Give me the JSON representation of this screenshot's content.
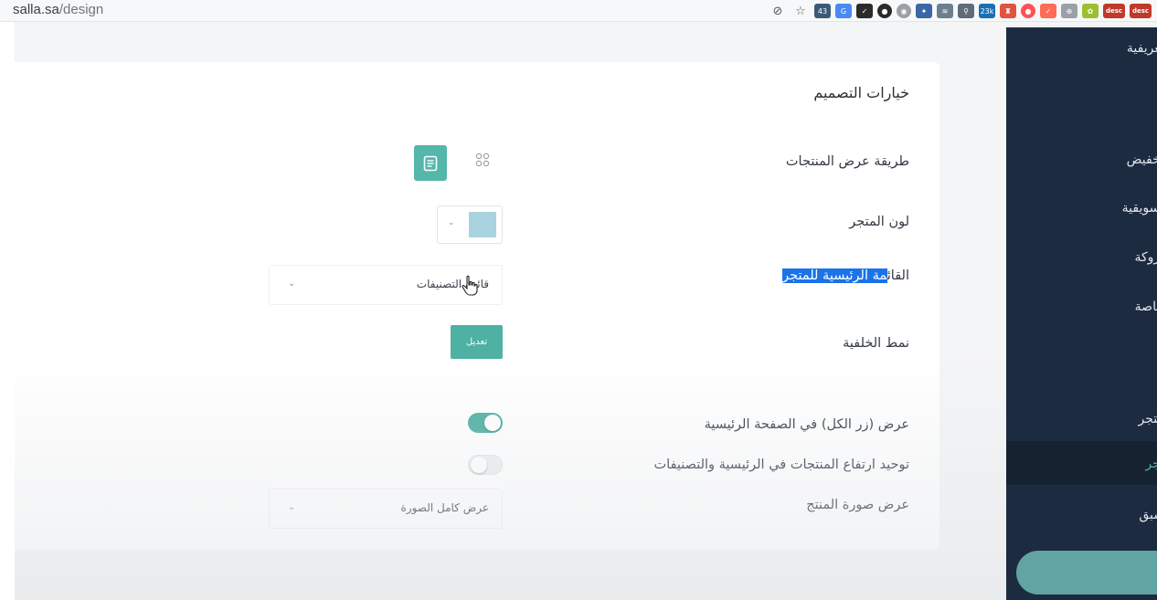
{
  "browser": {
    "url_domain": "salla.sa",
    "url_path": "/design",
    "extensions": [
      {
        "name": "eye-off-icon",
        "glyph": "⊘"
      },
      {
        "name": "star-icon",
        "glyph": "☆"
      },
      {
        "name": "extension-badge-43",
        "text": "43",
        "color": "#3b5a78"
      },
      {
        "name": "translate-extension-icon",
        "text": "G",
        "color": "#4a8af4"
      },
      {
        "name": "pocket-extension-icon",
        "text": "✓",
        "color": "#2b2b2b"
      },
      {
        "name": "extension-dark-circle-icon",
        "text": "●",
        "color": "#2a2a2a"
      },
      {
        "name": "extension-grey-circle-icon",
        "text": "◉",
        "color": "#9aa0a6"
      },
      {
        "name": "extension-spark-icon",
        "text": "✦",
        "color": "#3b67a8"
      },
      {
        "name": "rss-extension-icon",
        "text": "≋",
        "color": "#6c7f8f"
      },
      {
        "name": "link-extension-icon",
        "text": "⚲",
        "color": "#5f6b78"
      },
      {
        "name": "extension-badge-23k",
        "text": "23k",
        "color": "#1a6fb5"
      },
      {
        "name": "extension-lighthouse-icon",
        "text": "♜",
        "color": "#e0533f"
      },
      {
        "name": "extension-red-circle-icon",
        "text": "●",
        "color": "#ff5252"
      },
      {
        "name": "extension-red-check-icon",
        "text": "✓",
        "color": "#ff6b57"
      },
      {
        "name": "globe-extension-icon",
        "text": "⊕",
        "color": "#9aa0a6"
      },
      {
        "name": "extension-flower-icon",
        "text": "✿",
        "color": "#9cbf2f"
      }
    ],
    "desc_badge": "desc"
  },
  "sidebar": {
    "items": [
      {
        "label": "تعريفية"
      },
      {
        "label": "تخفيض"
      },
      {
        "label": "تسويقية"
      },
      {
        "label": "بروكة"
      },
      {
        "label": "خاصة"
      },
      {
        "label": "متجر"
      },
      {
        "label": "تجر"
      },
      {
        "label": "سبق"
      }
    ]
  },
  "design": {
    "section_title": "خيارات التصميم",
    "rows": {
      "display_method": "طريقة عرض المنتجات",
      "store_color": "لون المتجر",
      "main_menu_prefix": "القائ",
      "main_menu_highlight": "مة الرئيسية للمتجر",
      "background_style": "نمط الخلفية",
      "show_all_button": "عرض (زر الكل) في الصفحة الرئيسية",
      "unify_height": "توحيد ارتفاع المنتجات في الرئيسية والتصنيفات",
      "product_image": "عرض صورة المنتج"
    },
    "store_color_value": "#a9d3df",
    "main_menu_value": "قائمة التصنيفات",
    "edit_button": "تعديل",
    "product_image_value": "عرض كامل الصورة",
    "show_all_enabled": true,
    "unify_height_enabled": false,
    "display_mode": "list",
    "accent": "#4fb0a4"
  }
}
